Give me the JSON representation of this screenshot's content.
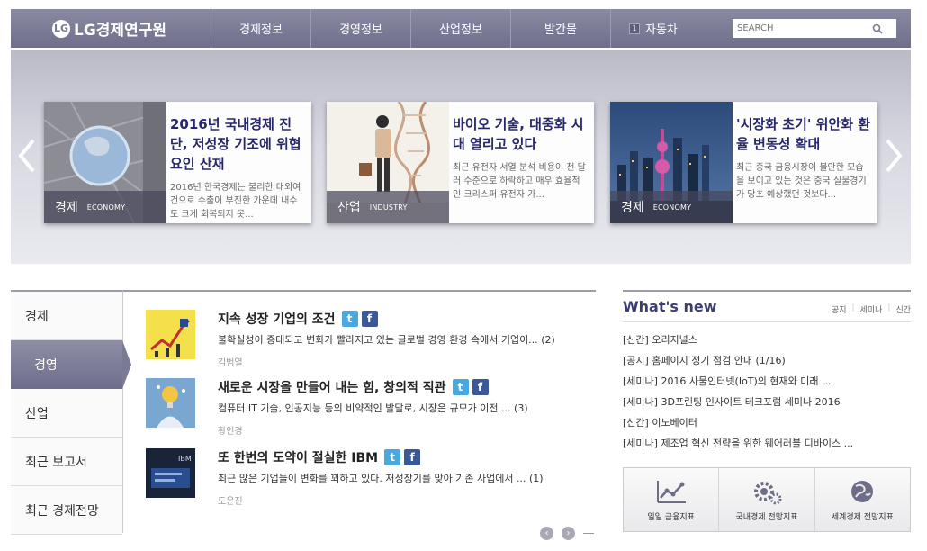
{
  "header": {
    "logo_text": "LG경제연구원",
    "logo_mark": "LG",
    "nav": [
      "경제정보",
      "경영정보",
      "산업정보",
      "발간물"
    ],
    "auto_tag": {
      "num": "1",
      "label": "자동차"
    },
    "search": {
      "placeholder": "SEARCH"
    }
  },
  "banner": {
    "cards": [
      {
        "title": "2016년 국내경제 진단, 저성장 기조에 위협요인 산재",
        "desc": "2016년 한국경제는 불리한 대외여건으로 수출이 부진한 가운데 내수도 크게 회복되지 못...",
        "cat_ko": "경제",
        "cat_en": "ECONOMY"
      },
      {
        "title": "바이오 기술, 대중화 시대 열리고 있다",
        "desc": "최근 유전자 서열 분석 비용이 천 달러 수준으로 하락하고 매우 효율적인 크리스퍼 유전자 가...",
        "cat_ko": "산업",
        "cat_en": "INDUSTRY"
      },
      {
        "title": "'시장화 초기' 위안화 환율 변동성 확대",
        "desc": "최근 중국 금융시장이 불안한 모습을 보이고 있는 것은 중국 실물경기가 당초 예상했던 것보다...",
        "cat_ko": "경제",
        "cat_en": "ECONOMY"
      }
    ]
  },
  "tabs": [
    "경제",
    "경영",
    "산업",
    "최근 보고서",
    "최근 경제전망"
  ],
  "articles": [
    {
      "title": "지속 성장 기업의 조건",
      "desc": "불확실성이 증대되고 변화가 빨라지고 있는 글로벌 경영 환경 속에서 기업이...",
      "count": "(2)",
      "author": "김범열"
    },
    {
      "title": "새로운 시장을 만들어 내는 힘, 창의적 직관",
      "desc": "컴퓨터 IT 기술, 인공지능 등의 비약적인 발달로, 시장은 규모가 이전 ...",
      "count": "(3)",
      "author": "황인경"
    },
    {
      "title": "또 한번의 도약이 절실한 IBM",
      "desc": "최근 많은 기업들이 변화를 꾀하고 있다. 저성장기를 맞아 기존 사업에서 ...",
      "count": "(1)",
      "author": "도은진"
    }
  ],
  "sns": {
    "twitter": "t",
    "facebook": "f"
  },
  "thumb3_text": "IBM",
  "news": {
    "title": "What's new",
    "tabs": [
      "공지",
      "세미나",
      "신간"
    ],
    "separator": "|",
    "items": [
      "[신간] 오리지널스",
      "[공지] 홈페이지 정기 점검 안내 (1/16)",
      "[세미나] 2016 사물인터넷(IoT)의 현재와 미래 ...",
      "[세미나] 3D프린팅 인사이트 테크포럼 세미나 2016",
      "[신간] 이노베이터",
      "[세미나] 제조업 혁신 전략을 위한 웨어러블 디바이스 ..."
    ]
  },
  "quick_links": [
    "일일 금융지표",
    "국내경제 전망지표",
    "세계경제 전망지표"
  ],
  "colors": {
    "header": "#7a7a95",
    "title": "#27276b",
    "accent": "#3d3d75",
    "twitter": "#4aa8dc",
    "facebook": "#3b5998"
  }
}
